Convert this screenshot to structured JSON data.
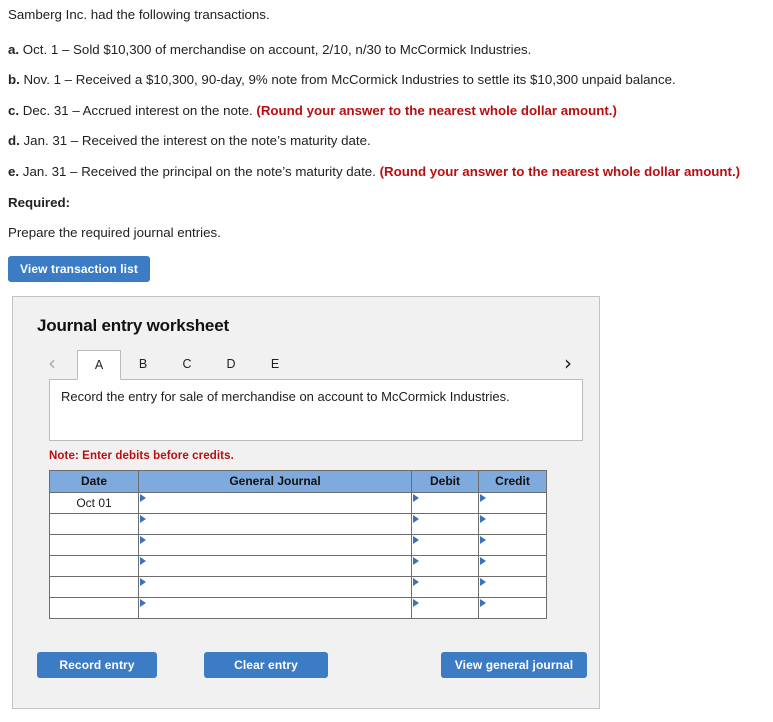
{
  "problem": {
    "intro": "Samberg Inc. had the following transactions.",
    "items": [
      {
        "letter": "a.",
        "text": "Oct. 1 – Sold $10,300 of merchandise on account, 2/10, n/30 to McCormick Industries.",
        "hint": ""
      },
      {
        "letter": "b.",
        "text": "Nov. 1 – Received a $10,300, 90-day, 9% note from McCormick Industries to settle its $10,300 unpaid balance.",
        "hint": ""
      },
      {
        "letter": "c.",
        "text": "Dec. 31 – Accrued interest on the note.",
        "hint": "(Round your answer to the nearest whole dollar amount.)"
      },
      {
        "letter": "d.",
        "text": "Jan. 31 – Received the interest on the note’s maturity date.",
        "hint": ""
      },
      {
        "letter": "e.",
        "text": "Jan. 31 – Received the principal on the note’s maturity date.",
        "hint": "(Round your answer to the nearest whole dollar amount.)"
      }
    ],
    "required_heading": "Required:",
    "required_body": "Prepare the required journal entries.",
    "view_transaction_list_label": "View transaction list"
  },
  "worksheet": {
    "title": "Journal entry worksheet",
    "prev_arrow": "‹",
    "next_arrow": "›",
    "tabs": [
      {
        "label": "A",
        "active": true
      },
      {
        "label": "B",
        "active": false
      },
      {
        "label": "C",
        "active": false
      },
      {
        "label": "D",
        "active": false
      },
      {
        "label": "E",
        "active": false
      }
    ],
    "description": "Record the entry for sale of merchandise on account to McCormick Industries.",
    "note": "Note: Enter debits before credits.",
    "table": {
      "headers": [
        "Date",
        "General Journal",
        "Debit",
        "Credit"
      ],
      "rows": [
        {
          "date": "Oct 01",
          "journal": "",
          "debit": "",
          "credit": ""
        },
        {
          "date": "",
          "journal": "",
          "debit": "",
          "credit": ""
        },
        {
          "date": "",
          "journal": "",
          "debit": "",
          "credit": ""
        },
        {
          "date": "",
          "journal": "",
          "debit": "",
          "credit": ""
        },
        {
          "date": "",
          "journal": "",
          "debit": "",
          "credit": ""
        },
        {
          "date": "",
          "journal": "",
          "debit": "",
          "credit": ""
        }
      ]
    },
    "buttons": {
      "record": "Record entry",
      "clear": "Clear entry",
      "view_general_journal": "View general journal"
    }
  },
  "colors": {
    "button_blue": "#3b7cc4",
    "table_header_blue": "#7eaadd",
    "hint_red": "#b90e10",
    "panel_bg": "#f1f1f1",
    "marker_blue": "#3b72b8"
  }
}
